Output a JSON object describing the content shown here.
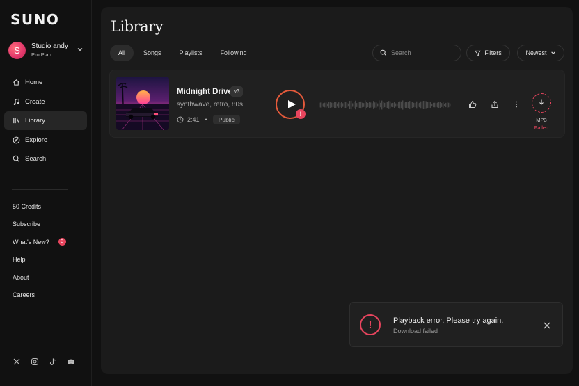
{
  "app": {
    "logo": "SUNO"
  },
  "profile": {
    "initial": "S",
    "name": "Studio andy",
    "plan": "Pro Plan"
  },
  "nav": [
    {
      "label": "Home",
      "icon": "home-icon"
    },
    {
      "label": "Create",
      "icon": "music-note-icon"
    },
    {
      "label": "Library",
      "icon": "library-icon",
      "active": true
    },
    {
      "label": "Explore",
      "icon": "compass-icon"
    },
    {
      "label": "Search",
      "icon": "search-icon"
    }
  ],
  "secondary": {
    "credits": "50 Credits",
    "subscribe": "Subscribe",
    "whats_new": "What's New?",
    "whats_new_badge": "3",
    "help": "Help",
    "about": "About",
    "careers": "Careers"
  },
  "social": [
    "x-icon",
    "instagram-icon",
    "tiktok-icon",
    "discord-icon"
  ],
  "library": {
    "title": "Library",
    "tabs": [
      {
        "label": "All",
        "active": true
      },
      {
        "label": "Songs"
      },
      {
        "label": "Playlists"
      },
      {
        "label": "Following"
      }
    ],
    "search_placeholder": "Search",
    "filters_label": "Filters",
    "sort_label": "Newest"
  },
  "track": {
    "title": "Midnight Drive",
    "version": "v3",
    "tags": "synthwave, retro, 80s",
    "duration": "2:41",
    "dot": "•",
    "visibility": "Public",
    "play_error_mark": "!",
    "download_format": "MP3",
    "download_status": "Failed"
  },
  "toast": {
    "icon_mark": "!",
    "title": "Playback error. Please try again.",
    "subtitle": "Download failed"
  },
  "colors": {
    "accent_error": "#e8455e",
    "play_ring": "#e45a3b",
    "panel": "#1b1b1b",
    "bg": "#111111"
  }
}
